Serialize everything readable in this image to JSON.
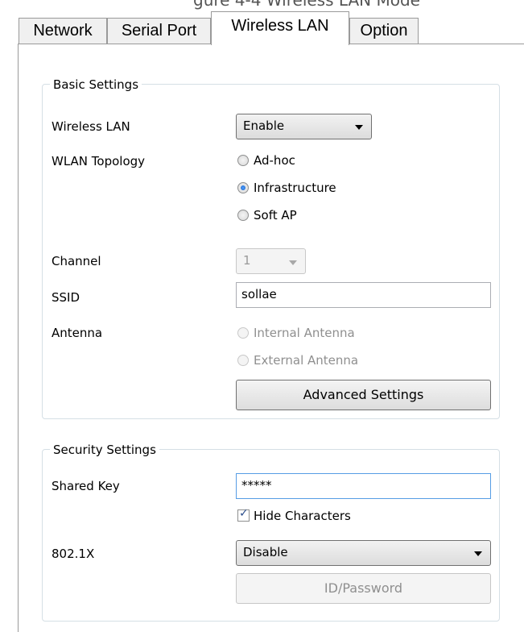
{
  "caption": "gure 4-4 Wireless LAN Mode",
  "tabs": [
    {
      "label": "Network"
    },
    {
      "label": "Serial Port"
    },
    {
      "label": "Wireless LAN"
    },
    {
      "label": "Option"
    }
  ],
  "basic": {
    "legend": "Basic Settings",
    "wireless_lan": {
      "label": "Wireless LAN",
      "value": "Enable"
    },
    "topology": {
      "label": "WLAN Topology",
      "options": [
        "Ad-hoc",
        "Infrastructure",
        "Soft AP"
      ],
      "selected": "Infrastructure"
    },
    "channel": {
      "label": "Channel",
      "value": "1"
    },
    "ssid": {
      "label": "SSID",
      "value": "sollae"
    },
    "antenna": {
      "label": "Antenna",
      "options": [
        "Internal Antenna",
        "External Antenna"
      ]
    },
    "advanced_button": "Advanced Settings"
  },
  "security": {
    "legend": "Security Settings",
    "shared_key": {
      "label": "Shared Key",
      "value": "*****"
    },
    "hide_characters": {
      "label": "Hide Characters",
      "checked": true
    },
    "dot1x": {
      "label": "802.1X",
      "value": "Disable"
    },
    "id_password_button": "ID/Password"
  }
}
